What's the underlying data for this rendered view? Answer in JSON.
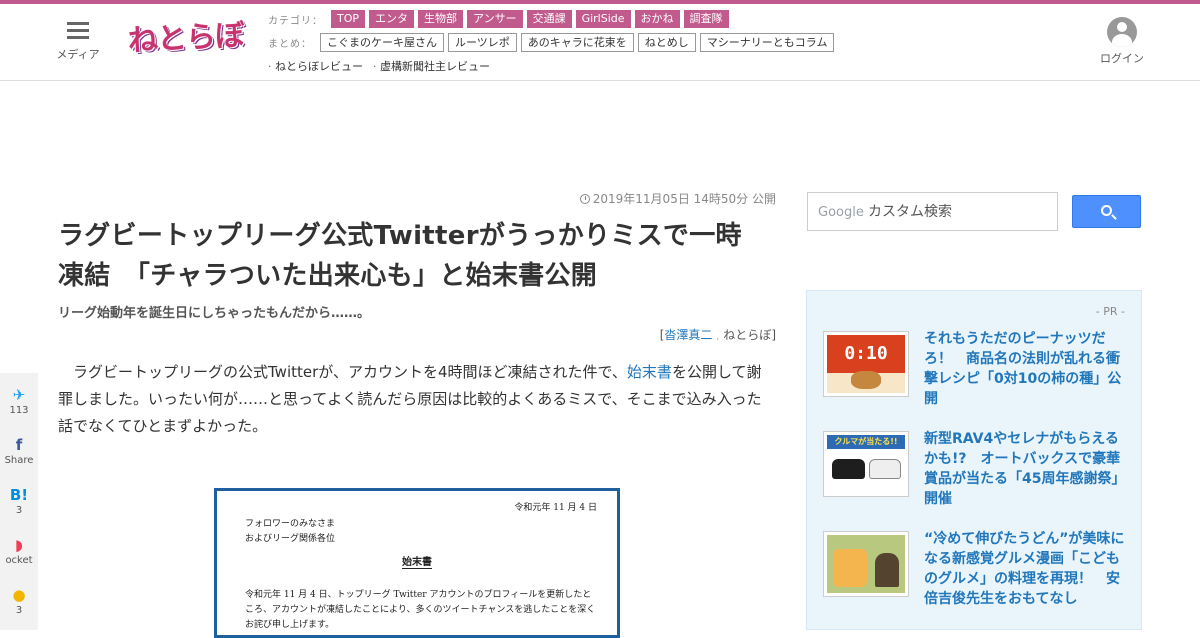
{
  "header": {
    "menu_label": "メディア",
    "logo_text": "ねとらぼ",
    "category_label": "カテゴリ：",
    "categories": [
      "TOP",
      "エンタ",
      "生物部",
      "アンサー",
      "交通課",
      "GirlSide",
      "おかね",
      "調査隊"
    ],
    "matome_label": "まとめ：",
    "matome": [
      "こぐまのケーキ屋さん",
      "ルーツレポ",
      "あのキャラに花束を",
      "ねとめし",
      "マシーナリーともコラム"
    ],
    "reviews": [
      "ねとらぼレビュー",
      "虚構新聞社主レビュー"
    ],
    "login_label": "ログイン"
  },
  "article": {
    "date": "2019年11月05日 14時50分 公開",
    "title_line1": "ラグビートップリーグ公式Twitterがうっかりミスで一時",
    "title_line2": "凍結　「チャラついた出来心も」と始末書公開",
    "subtitle": "リーグ始動年を誕生日にしちゃったもんだから……。",
    "byline_open": "[",
    "author": "沓澤真二",
    "byline_sep": ",",
    "publisher": "ねとらぼ",
    "byline_close": "]",
    "lede_part1": "ラグビートップリーグの公式Twitterが、アカウントを4時間ほど凍結された件で、",
    "lede_link": "始末書",
    "lede_part2": "を公開して謝罪しました。いったい何が……と思ってよく読んだら原因は比較的よくあるミスで、そこまで込み入った話でなくてひとまずよかった。"
  },
  "document": {
    "date": "令和元年 11 月 4 日",
    "to1": "フォロワーのみなさま",
    "to2": "およびリーグ関係各位",
    "title": "始末書",
    "body": "令和元年 11 月 4 日、トップリーグ Twitter アカウントのプロフィールを更新したところ、アカウントが凍結したことにより、多くのツイートチャンスを逃したことを深くお詫び申し上げます。"
  },
  "share": {
    "twitter_count": "113",
    "facebook_label": "Share",
    "hatena_count": "3",
    "pocket_label": "ocket",
    "comment_count": "3"
  },
  "search": {
    "google_label": "Google",
    "placeholder": "カスタム検索"
  },
  "pr": {
    "label": "- PR -",
    "items": [
      {
        "title": "それもうただのピーナッツだろ！　商品名の法則が乱れる衝撃レシピ「0対10の柿の種」公開",
        "thumb_text": "0:10"
      },
      {
        "title": "新型RAV4やセレナがもらえるかも!?　オートバックスで豪華賞品が当たる「45周年感謝祭」開催",
        "thumb_text": "クルマが当たる!!"
      },
      {
        "title": "“冷めて伸びたうどん”が美味になる新感覚グルメ漫画「こどものグルメ」の料理を再現！　安倍吉俊先生をおもてなし"
      }
    ]
  }
}
